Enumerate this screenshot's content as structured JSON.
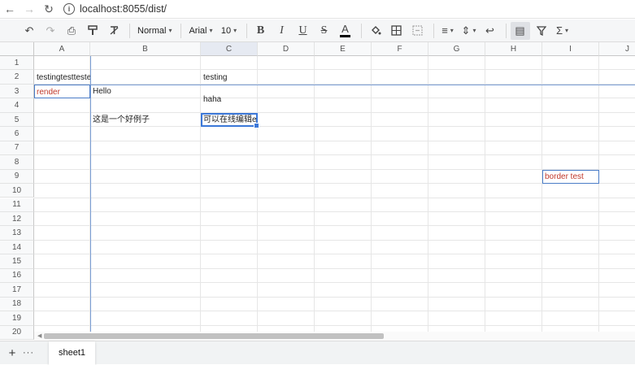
{
  "browser": {
    "url": "localhost:8055/dist/",
    "info_glyph": "i"
  },
  "toolbar": {
    "undo_glyph": "↶",
    "redo_glyph": "↷",
    "print_glyph": "⎙",
    "paint_format_glyph": "🖌",
    "clear_format_glyph": "T̸",
    "format_label": "Normal",
    "font_family": "Arial",
    "font_size": "10",
    "bold_glyph": "B",
    "italic_glyph": "I",
    "underline_glyph": "U",
    "strike_glyph": "S",
    "text_color_glyph": "A",
    "fill_glyph": "◈",
    "border_glyph": "⊞",
    "merge_glyph": "⊟",
    "align_glyph": "≡",
    "valign_glyph": "⇕",
    "wrap_glyph": "↩",
    "freeze_glyph": "▤",
    "filter_glyph": "⏷",
    "function_glyph": "Σ",
    "caret": "▾"
  },
  "grid": {
    "columns": [
      "A",
      "B",
      "C",
      "D",
      "E",
      "F",
      "G",
      "H",
      "I",
      "J"
    ],
    "rows": [
      "1",
      "2",
      "3",
      "4",
      "5",
      "6",
      "7",
      "8",
      "9",
      "10",
      "11",
      "12",
      "13",
      "14",
      "15",
      "16",
      "17",
      "18",
      "19",
      "20"
    ],
    "cells": {
      "A2": "testingtesttestetsetset",
      "C2": "testing",
      "A3": "render",
      "B3": "Hello",
      "C3": "haha",
      "B5": "这是一个好例子",
      "C5": "可以在线编辑excel",
      "I9": "border test"
    },
    "red_text_color": "#c0392b",
    "selection_color": "#3c78d8"
  },
  "sheetbar": {
    "add_glyph": "+",
    "more_glyph": "···",
    "sheets": [
      "sheet1"
    ]
  }
}
